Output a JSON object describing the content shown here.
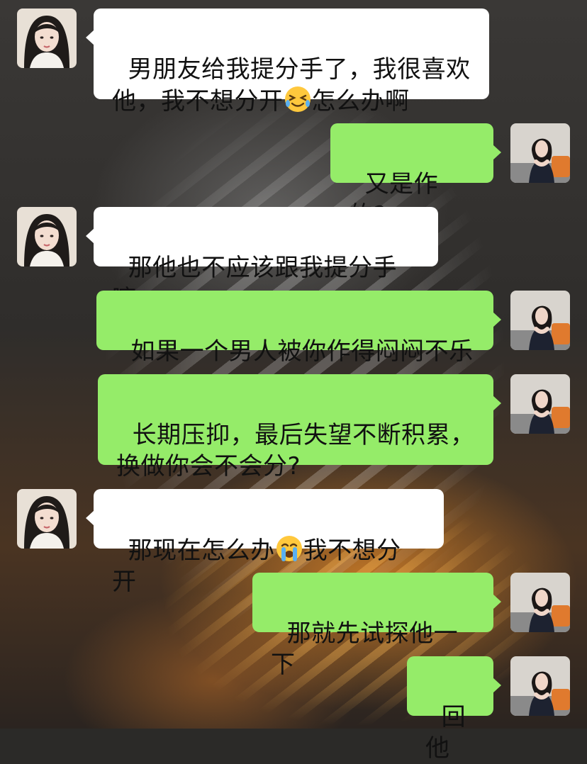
{
  "messages": [
    {
      "side": "left",
      "text_a": "男朋友给我提分手了，我很喜欢他，我不想分开",
      "emoji": "tears-of-joy-squint-emoji",
      "text_b": "怎么办啊"
    },
    {
      "side": "right",
      "text": "又是作的?"
    },
    {
      "side": "left",
      "text": "那他也不应该跟我提分手嘛"
    },
    {
      "side": "right",
      "text": "如果一个男人被你作得闷闷不乐"
    },
    {
      "side": "right",
      "text": "长期压抑，最后失望不断积累，换做你会不会分?"
    },
    {
      "side": "left",
      "text_a": "那现在怎么办",
      "emoji": "loudly-crying-emoji",
      "text_b": "我不想分开"
    },
    {
      "side": "right",
      "text": "那就先试探他一下"
    },
    {
      "side": "right",
      "text": "回他"
    }
  ],
  "colors": {
    "incoming_bubble": "#ffffff",
    "outgoing_bubble": "#95ec69"
  },
  "icons": {
    "left_avatar": "girl-avatar-icon",
    "right_avatar": "woman-avatar-icon"
  }
}
